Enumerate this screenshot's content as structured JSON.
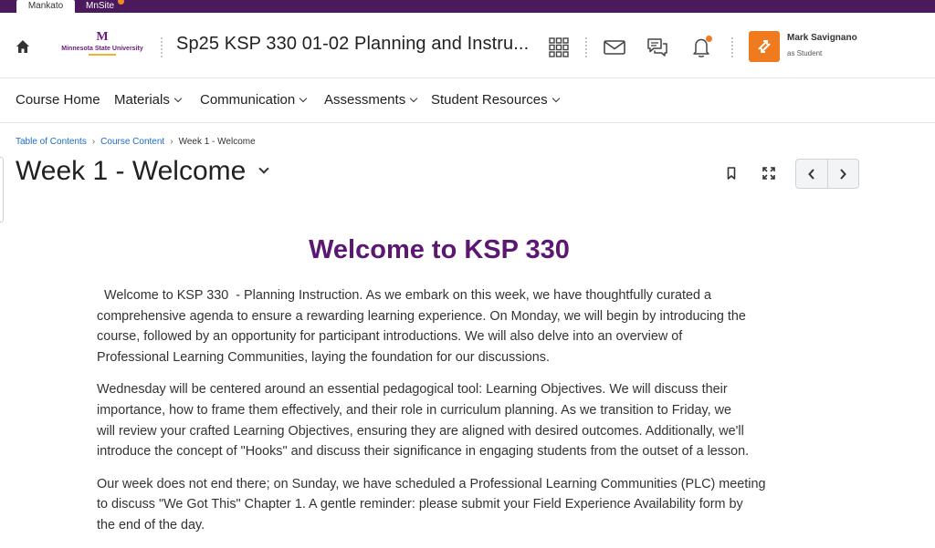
{
  "top_tabs": {
    "mankato": "Mankato",
    "minsite": "MnSite"
  },
  "header": {
    "logo_letter": "M",
    "logo_text": "Minnesota State University",
    "course_title": "Sp25 KSP 330 01-02 Planning and Instru...",
    "user_name": "Mark Savignano",
    "user_role": "as Student",
    "icons": [
      "home-icon",
      "waffle-icon",
      "mail-icon",
      "chat-icon",
      "bell-icon"
    ],
    "accent_color": "#f07a1e"
  },
  "nav": {
    "course_home": "Course Home",
    "materials": "Materials",
    "communication": "Communication",
    "assessments": "Assessments",
    "student_resources": "Student Resources"
  },
  "breadcrumb": {
    "table_of_contents": "Table of Contents",
    "course_content": "Course Content",
    "current": "Week 1 - Welcome",
    "separator": "›"
  },
  "page": {
    "title": "Week 1 - Welcome",
    "heading": "Welcome to KSP 330",
    "heading_color": "#5b1771"
  },
  "paragraphs": [
    [
      "  Welcome to KSP 330  - Planning Instruction. As we embark on this week, we have thoughtfully curated a",
      "comprehensive agenda to ensure a rewarding learning experience. On Monday, we will begin by introducing the",
      "course, followed by an opportunity for participant introductions. We will also delve into an overview of",
      "Professional Learning Communities, laying the foundation for our discussions."
    ],
    [
      "Wednesday will be centered around an essential pedagogical tool: Learning Objectives. We will discuss their",
      "importance, how to frame them effectively, and their role in curriculum planning. As we transition to Friday, we",
      "will review your crafted Learning Objectives, ensuring they are aligned with desired outcomes. Additionally, we'll",
      "introduce the concept of \"Hooks\" and discuss their significance in engaging students from the outset of a lesson."
    ],
    [
      "Our week does not end there; on Sunday, we have scheduled a Professional Learning Communities (PLC) meeting",
      "to discuss \"We Got This\" Chapter 1. A gentle reminder: please submit your Field Experience Availability form by",
      "the end of the day."
    ]
  ]
}
